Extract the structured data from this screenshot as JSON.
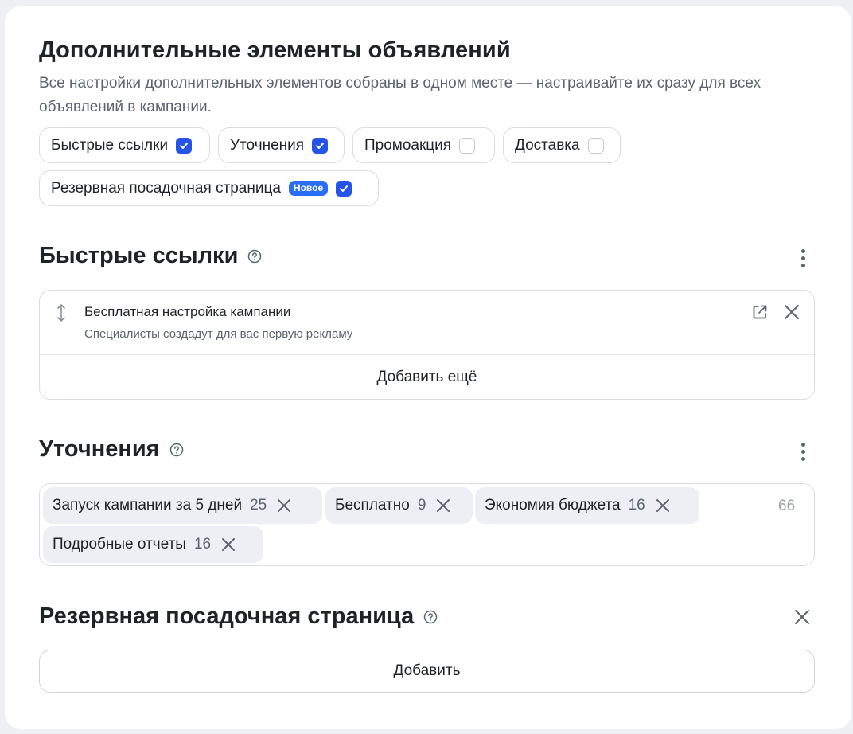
{
  "header": {
    "title": "Дополнительные элементы объявлений",
    "description": "Все настройки дополнительных элементов собраны в одном месте — настраивайте их сразу для всех объявлений в кампании."
  },
  "toggles": [
    {
      "label": "Быстрые ссылки",
      "checked": true
    },
    {
      "label": "Уточнения",
      "checked": true
    },
    {
      "label": "Промоакция",
      "checked": false
    },
    {
      "label": "Доставка",
      "checked": false
    },
    {
      "label": "Резервная посадочная страница",
      "badge": "Новое",
      "checked": true
    }
  ],
  "quick_links": {
    "title": "Быстрые ссылки",
    "items": [
      {
        "title": "Бесплатная настройка кампании",
        "description": "Специалисты создадут для вас первую рекламу"
      }
    ],
    "add_label": "Добавить ещё"
  },
  "callouts": {
    "title": "Уточнения",
    "tags": [
      {
        "text": "Запуск кампании за 5 дней",
        "count": "25"
      },
      {
        "text": "Бесплатно",
        "count": "9"
      },
      {
        "text": "Экономия бюджета",
        "count": "16"
      },
      {
        "text": "Подробные отчеты",
        "count": "16"
      }
    ],
    "remaining": "66"
  },
  "fallback_page": {
    "title": "Резервная посадочная страница",
    "add_label": "Добавить"
  },
  "colors": {
    "accent": "#2654e8",
    "badge": "#2a6ef5",
    "text": "#1f2328",
    "muted": "#5c6470",
    "border": "#d9dce2",
    "tag_bg": "#edeff4",
    "page_bg": "#eef0f4"
  }
}
